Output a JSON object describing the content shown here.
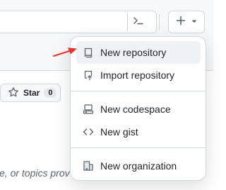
{
  "header": {
    "command_palette_icon": "terminal-icon",
    "create_new_icon": "plus-icon",
    "dropdown_icon": "triangle-down-icon"
  },
  "repo": {
    "star_label": "Star",
    "star_count": "0"
  },
  "background_text": "e, or topics prov",
  "menu": {
    "items": [
      {
        "label": "New repository",
        "icon": "repo-icon",
        "highlighted": true
      },
      {
        "label": "Import repository",
        "icon": "repo-push-icon",
        "highlighted": false
      },
      {
        "label": "New codespace",
        "icon": "codespaces-icon",
        "highlighted": false
      },
      {
        "label": "New gist",
        "icon": "code-icon",
        "highlighted": false
      },
      {
        "label": "New organization",
        "icon": "organization-icon",
        "highlighted": false
      }
    ]
  },
  "annotation": {
    "arrow_color": "#e8352b",
    "arrow_target": "New repository"
  },
  "colors": {
    "menu_highlight": "#eff2f5",
    "border": "#d1d9e0",
    "text": "#1f2328",
    "muted": "#59636e"
  }
}
